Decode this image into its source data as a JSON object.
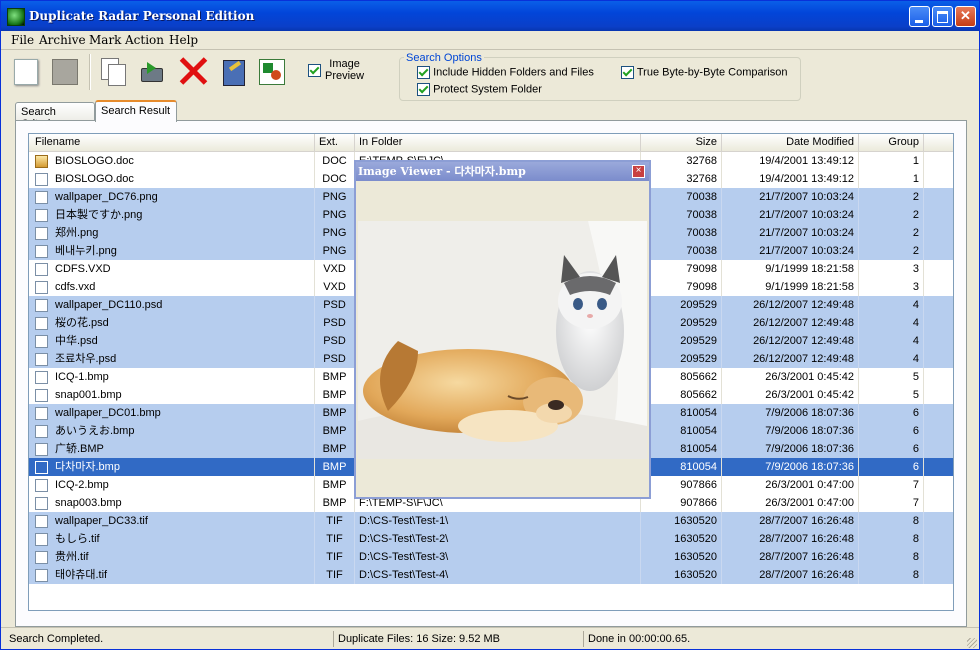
{
  "window": {
    "title": "Duplicate Radar Personal Edition"
  },
  "menu": [
    "File",
    "Archive",
    "Mark",
    "Action",
    "Help"
  ],
  "toolbar": {
    "image_preview_label_line1": "Image",
    "image_preview_label_line2": "Preview",
    "image_preview_checked": true
  },
  "search_options": {
    "legend": "Search Options",
    "include_hidden": "Include Hidden Folders and Files",
    "protect_system": "Protect System Folder",
    "byte_compare": "True Byte-by-Byte Comparison"
  },
  "tabs": [
    "Search Criteria",
    "Search Result"
  ],
  "columns": [
    "Filename",
    "Ext.",
    "In Folder",
    "Size",
    "Date Modified",
    "Group"
  ],
  "rows": [
    {
      "name": "BIOSLOGO.doc",
      "ext": "DOC",
      "folder": "E:\\TEMP-S\\E\\JC\\",
      "size": "32768",
      "date": "19/4/2001 13:49:12",
      "group": "1"
    },
    {
      "name": "BIOSLOGO.doc",
      "ext": "DOC",
      "folder": "",
      "size": "32768",
      "date": "19/4/2001 13:49:12",
      "group": "1"
    },
    {
      "name": "wallpaper_DC76.png",
      "ext": "PNG",
      "folder": "",
      "size": "70038",
      "date": "21/7/2007 10:03:24",
      "group": "2"
    },
    {
      "name": "日本製ですか.png",
      "ext": "PNG",
      "folder": "",
      "size": "70038",
      "date": "21/7/2007 10:03:24",
      "group": "2"
    },
    {
      "name": "郑州.png",
      "ext": "PNG",
      "folder": "",
      "size": "70038",
      "date": "21/7/2007 10:03:24",
      "group": "2"
    },
    {
      "name": "베내누키.png",
      "ext": "PNG",
      "folder": "",
      "size": "70038",
      "date": "21/7/2007 10:03:24",
      "group": "2"
    },
    {
      "name": "CDFS.VXD",
      "ext": "VXD",
      "folder": "",
      "size": "79098",
      "date": "9/1/1999 18:21:58",
      "group": "3"
    },
    {
      "name": "cdfs.vxd",
      "ext": "VXD",
      "folder": "",
      "size": "79098",
      "date": "9/1/1999 18:21:58",
      "group": "3"
    },
    {
      "name": "wallpaper_DC110.psd",
      "ext": "PSD",
      "folder": "",
      "size": "209529",
      "date": "26/12/2007 12:49:48",
      "group": "4"
    },
    {
      "name": "桜の花.psd",
      "ext": "PSD",
      "folder": "",
      "size": "209529",
      "date": "26/12/2007 12:49:48",
      "group": "4"
    },
    {
      "name": "中华.psd",
      "ext": "PSD",
      "folder": "",
      "size": "209529",
      "date": "26/12/2007 12:49:48",
      "group": "4"
    },
    {
      "name": "조료차우.psd",
      "ext": "PSD",
      "folder": "",
      "size": "209529",
      "date": "26/12/2007 12:49:48",
      "group": "4"
    },
    {
      "name": "ICQ-1.bmp",
      "ext": "BMP",
      "folder": "",
      "size": "805662",
      "date": "26/3/2001 0:45:42",
      "group": "5"
    },
    {
      "name": "snap001.bmp",
      "ext": "BMP",
      "folder": "",
      "size": "805662",
      "date": "26/3/2001 0:45:42",
      "group": "5"
    },
    {
      "name": "wallpaper_DC01.bmp",
      "ext": "BMP",
      "folder": "",
      "size": "810054",
      "date": "7/9/2006 18:07:36",
      "group": "6"
    },
    {
      "name": "あいうえお.bmp",
      "ext": "BMP",
      "folder": "",
      "size": "810054",
      "date": "7/9/2006 18:07:36",
      "group": "6"
    },
    {
      "name": "广轿.BMP",
      "ext": "BMP",
      "folder": "",
      "size": "810054",
      "date": "7/9/2006 18:07:36",
      "group": "6"
    },
    {
      "name": "다차마자.bmp",
      "ext": "BMP",
      "folder": "",
      "size": "810054",
      "date": "7/9/2006 18:07:36",
      "group": "6",
      "selected": true
    },
    {
      "name": "ICQ-2.bmp",
      "ext": "BMP",
      "folder": "",
      "size": "907866",
      "date": "26/3/2001 0:47:00",
      "group": "7"
    },
    {
      "name": "snap003.bmp",
      "ext": "BMP",
      "folder": "F:\\TEMP-S\\F\\JC\\",
      "size": "907866",
      "date": "26/3/2001 0:47:00",
      "group": "7"
    },
    {
      "name": "wallpaper_DC33.tif",
      "ext": "TIF",
      "folder": "D:\\CS-Test\\Test-1\\",
      "size": "1630520",
      "date": "28/7/2007 16:26:48",
      "group": "8"
    },
    {
      "name": "もしら.tif",
      "ext": "TIF",
      "folder": "D:\\CS-Test\\Test-2\\",
      "size": "1630520",
      "date": "28/7/2007 16:26:48",
      "group": "8"
    },
    {
      "name": "贵州.tif",
      "ext": "TIF",
      "folder": "D:\\CS-Test\\Test-3\\",
      "size": "1630520",
      "date": "28/7/2007 16:26:48",
      "group": "8"
    },
    {
      "name": "태야츄대.tif",
      "ext": "TIF",
      "folder": "D:\\CS-Test\\Test-4\\",
      "size": "1630520",
      "date": "28/7/2007 16:26:48",
      "group": "8"
    }
  ],
  "viewer": {
    "title": "Image Viewer - 다차마자.bmp"
  },
  "status": {
    "left": "Search Completed.",
    "middle": "Duplicate Files: 16  Size: 9.52 MB",
    "right": "Done in 00:00:00.65."
  },
  "colors": {
    "group_band": "#b6cdee",
    "selection": "#316ac5",
    "title_bar": "#0245d9"
  }
}
